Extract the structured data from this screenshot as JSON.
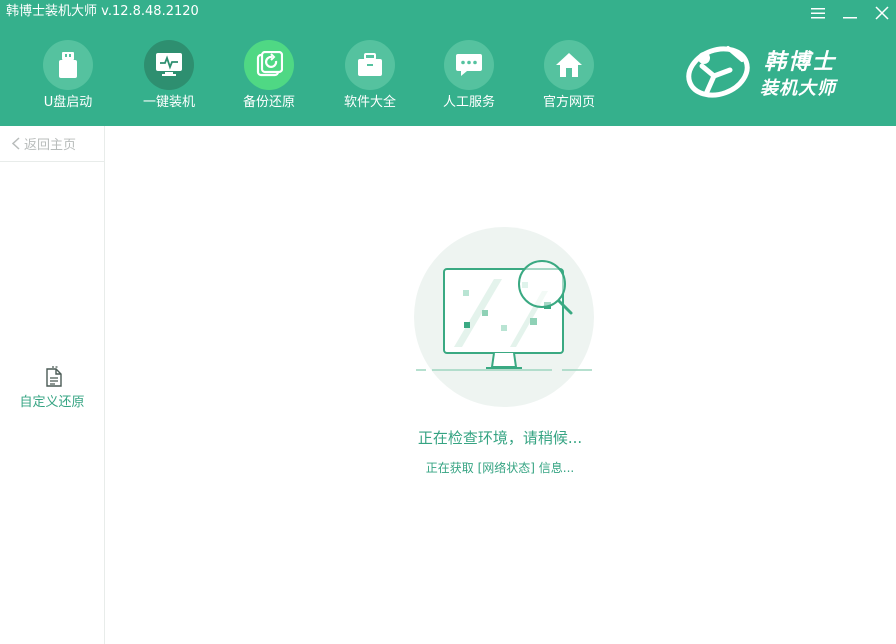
{
  "window": {
    "title": "韩博士装机大师 v.12.8.48.2120"
  },
  "nav": {
    "items": [
      {
        "label": "U盘启动",
        "icon": "usb-icon"
      },
      {
        "label": "一键装机",
        "icon": "monitor-icon"
      },
      {
        "label": "备份还原",
        "icon": "backup-icon"
      },
      {
        "label": "软件大全",
        "icon": "briefcase-icon"
      },
      {
        "label": "人工服务",
        "icon": "chat-icon"
      },
      {
        "label": "官方网页",
        "icon": "home-icon"
      }
    ]
  },
  "logo": {
    "line1": "韩博士",
    "line2": "装机大师"
  },
  "sidebar": {
    "back_label": "返回主页",
    "item_label": "自定义还原"
  },
  "main": {
    "status_title": "正在检查环境，请稍候...",
    "status_detail": "正在获取 [网络状态] 信息..."
  },
  "colors": {
    "header_bg": "#35b08c",
    "accent": "#36a483"
  }
}
